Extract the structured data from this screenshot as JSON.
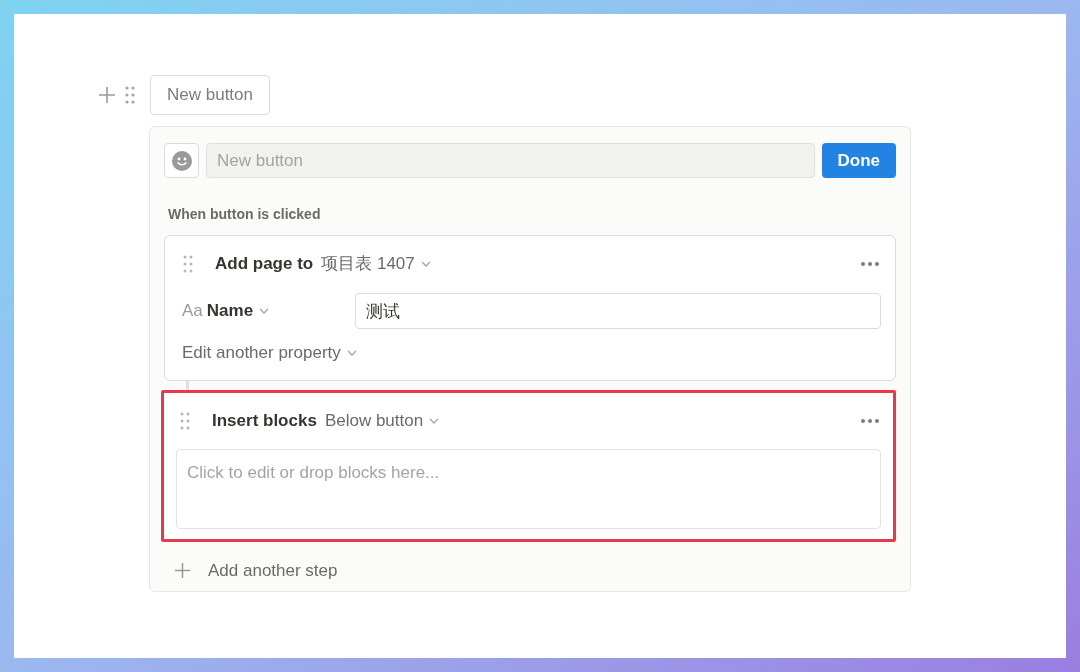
{
  "top_button": {
    "label": "New button"
  },
  "editor": {
    "name_field": {
      "placeholder": "New button"
    },
    "done_button": "Done",
    "trigger_label": "When button is clicked",
    "steps": [
      {
        "kind": "add_page",
        "action": "Add page to",
        "target": "项目表 1407",
        "highlighted": false,
        "properties": [
          {
            "icon": "Aa",
            "name": "Name",
            "value": "测试"
          }
        ],
        "edit_more": "Edit another property"
      },
      {
        "kind": "insert_blocks",
        "action": "Insert blocks",
        "target": "Below button",
        "highlighted": true,
        "content": {
          "placeholder": "Click to edit or drop blocks here..."
        }
      }
    ],
    "add_step": "Add another step"
  }
}
